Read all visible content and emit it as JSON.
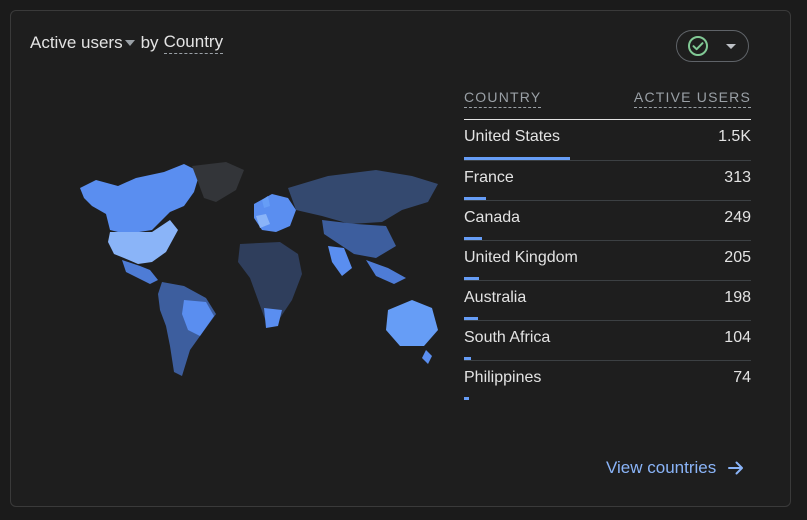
{
  "card": {
    "metric_label": "Active users",
    "by_label": "by",
    "dimension_label": "Country"
  },
  "table": {
    "col_country": "COUNTRY",
    "col_users": "ACTIVE USERS",
    "rows": [
      {
        "country": "United States",
        "users": "1.5K",
        "share": 1.0
      },
      {
        "country": "France",
        "users": "313",
        "share": 0.21
      },
      {
        "country": "Canada",
        "users": "249",
        "share": 0.17
      },
      {
        "country": "United Kingdom",
        "users": "205",
        "share": 0.14
      },
      {
        "country": "Australia",
        "users": "198",
        "share": 0.13
      },
      {
        "country": "South Africa",
        "users": "104",
        "share": 0.07
      },
      {
        "country": "Philippines",
        "users": "74",
        "share": 0.05
      }
    ]
  },
  "footer": {
    "view_link": "View countries"
  },
  "colors": {
    "accent": "#669df6",
    "link": "#8ab4f8",
    "check": "#81c995"
  }
}
